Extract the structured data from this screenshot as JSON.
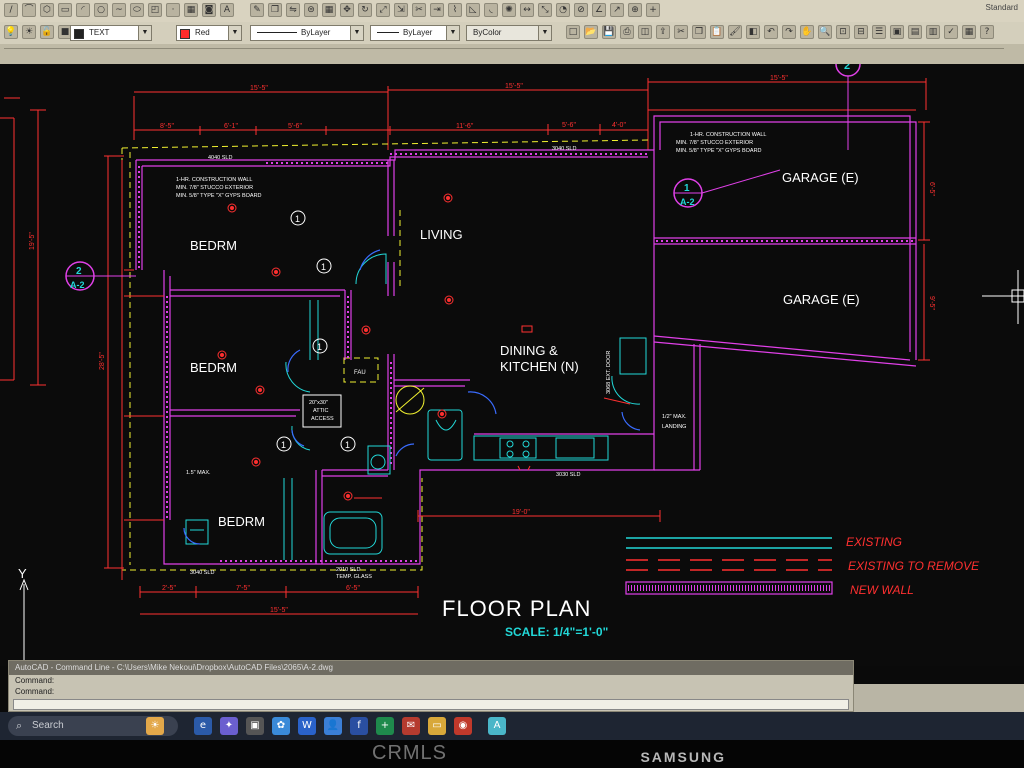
{
  "toolbar": {
    "text_style": "TEXT",
    "color": "Red",
    "color_hex": "#ff2a2a",
    "linetype": "ByLayer",
    "lineweight": "ByLayer",
    "plotstyle": "ByColor",
    "workspace": "Standard"
  },
  "drawing": {
    "rooms": {
      "bedroom1": "BEDRM",
      "bedroom2": "BEDRM",
      "bedroom3": "BEDRM",
      "living": "LIVING",
      "dining_line1": "DINING &",
      "dining_line2": "KITCHEN (N)",
      "garage1": "GARAGE (E)",
      "garage2": "GARAGE (E)"
    },
    "notes": {
      "wall_note_1": "1-HR. CONSTRUCTION WALL",
      "wall_note_2": "MIN. 7/8\" STUCCO EXTERIOR",
      "wall_note_3": "MIN. 5/8\" TYPE \"X\" GYPS BOARD",
      "attic": "20\"x30\"",
      "attic2": "ATTIC",
      "attic3": "ACCESS",
      "fau": "FAU",
      "landing": "1/2\" MAX.",
      "landing2": "LANDING",
      "max15": "1.5\" MAX.",
      "ext_door": "3068 EXT. DOOR",
      "win_1": "4040 SLD",
      "win_2": "3040 SLD",
      "win_3": "3030 SLD",
      "win_4": "3040 SLD",
      "win_5": "2010 SLD",
      "win_5b": "TEMP. GLASS"
    },
    "dimensions": {
      "top_overall": "15'-5\"",
      "top_overall_2": "15'-5\"",
      "top_overall_3": "15'-5\"",
      "d1": "8'-5\"",
      "d2": "6'-1\"",
      "d3": "5'-6\"",
      "d4": "11'-6\"",
      "d5": "5'-6\"",
      "d6": "4'-0\"",
      "bottom_overall": "15'-5\"",
      "b1": "2'-5\"",
      "b2": "7'-5\"",
      "b3": "6'-5\"",
      "kitchen_w": "19'-0\"",
      "left_overall": "28'-5\"",
      "left_2": "19'-5\"",
      "right_1": "6'-5\"",
      "right_2": "9'-5\""
    },
    "section_markers": {
      "top_num": "2",
      "mid_num": "1",
      "mid_sheet": "A-2",
      "left_num": "2",
      "left_sheet": "A-2"
    },
    "legend": {
      "existing": "EXISTING",
      "to_remove": "EXISTING TO REMOVE",
      "new_wall": "NEW WALL"
    },
    "title": "FLOOR PLAN",
    "scale": "SCALE: 1/4\"=1'-0\"",
    "ucs_y": "Y",
    "colors": {
      "wall": "#e040e8",
      "dim": "#ff3030",
      "existing": "#22d8d8",
      "hidden": "#f2f230",
      "text": "#ffffff",
      "scale_text": "#22d8d8",
      "legend_text": "#ff3030"
    }
  },
  "command_line": {
    "title": "AutoCAD - Command Line - C:\\Users\\Mike Nekoui\\Dropbox\\AutoCAD Files\\2065\\A-2.dwg",
    "line1": "Command:",
    "line2": "Command:"
  },
  "taskbar": {
    "search_placeholder": "Search"
  },
  "bezel": {
    "brand": "SAMSUNG",
    "watermark": "CRMLS"
  }
}
